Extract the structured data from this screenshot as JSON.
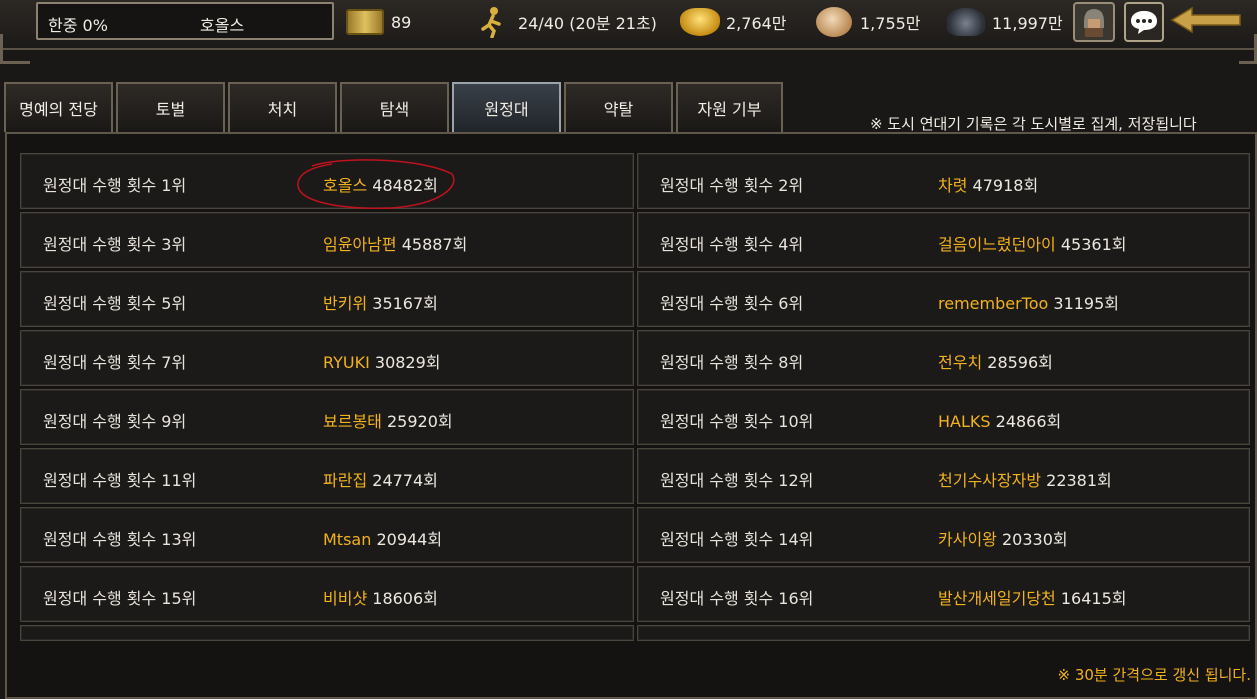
{
  "topbar": {
    "loyalty": "한중 0%",
    "city_name": "호올스",
    "scrolls": "89",
    "stamina": "24/40 (20분 21초)",
    "gold": "2,764만",
    "food": "1,755만",
    "ore": "11,997만"
  },
  "icons": {
    "scroll": "scroll-icon",
    "stamina": "runner-icon",
    "gold": "gold-icon",
    "food": "food-icon",
    "ore": "ore-icon",
    "avatar": "helmet-avatar-icon",
    "chat": "chat-bubble-icon",
    "back": "arrow-left-icon"
  },
  "tabs": [
    {
      "label": "명예의 전당",
      "active": false
    },
    {
      "label": "토벌",
      "active": false
    },
    {
      "label": "처치",
      "active": false
    },
    {
      "label": "탐색",
      "active": false
    },
    {
      "label": "원정대",
      "active": true
    },
    {
      "label": "약탈",
      "active": false
    },
    {
      "label": "자원 기부",
      "active": false
    }
  ],
  "notice_top": "※ 도시 연대기 기록은 각 도시별로 집계, 저장됩니다",
  "rankings": [
    {
      "rank_label": "원정대 수행 횟수 1위",
      "player": "호올스",
      "count": "48482회"
    },
    {
      "rank_label": "원정대 수행 횟수 2위",
      "player": "차렷",
      "count": "47918회"
    },
    {
      "rank_label": "원정대 수행 횟수 3위",
      "player": "임윤아남편",
      "count": "45887회"
    },
    {
      "rank_label": "원정대 수행 횟수 4위",
      "player": "걸음이느렸던아이",
      "count": "45361회"
    },
    {
      "rank_label": "원정대 수행 횟수 5위",
      "player": "반키위",
      "count": "35167회"
    },
    {
      "rank_label": "원정대 수행 횟수 6위",
      "player": "rememberToo",
      "count": "31195회"
    },
    {
      "rank_label": "원정대 수행 횟수 7위",
      "player": "RYUKI",
      "count": "30829회"
    },
    {
      "rank_label": "원정대 수행 횟수 8위",
      "player": "전우치",
      "count": "28596회"
    },
    {
      "rank_label": "원정대 수행 횟수 9위",
      "player": "뵤르봉태",
      "count": "25920회"
    },
    {
      "rank_label": "원정대 수행 횟수 10위",
      "player": "HALKS",
      "count": "24866회"
    },
    {
      "rank_label": "원정대 수행 횟수 11위",
      "player": "파란집",
      "count": "24774회"
    },
    {
      "rank_label": "원정대 수행 횟수 12위",
      "player": "천기수사장자방",
      "count": "22381회"
    },
    {
      "rank_label": "원정대 수행 횟수 13위",
      "player": "Mtsan",
      "count": "20944회"
    },
    {
      "rank_label": "원정대 수행 횟수 14위",
      "player": "카사이왕",
      "count": "20330회"
    },
    {
      "rank_label": "원정대 수행 횟수 15위",
      "player": "비비샷",
      "count": "18606회"
    },
    {
      "rank_label": "원정대 수행 횟수 16위",
      "player": "발산개세일기당천",
      "count": "16415회"
    }
  ],
  "notice_bottom": "※ 30분 간격으로 갱신 됩니다.",
  "colors": {
    "player_name": "#f2b21e",
    "highlight_circle": "#c0121e",
    "active_tab": "#3a4048"
  }
}
